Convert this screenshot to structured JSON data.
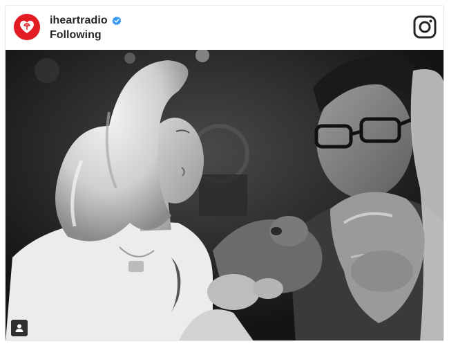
{
  "post": {
    "account": {
      "username": "iheartradio",
      "verified": true,
      "follow_status": "Following",
      "avatar_icon": "iheartradio-logo-icon",
      "brand_color": "#e31b23",
      "verified_color": "#3897f0"
    },
    "header_icon": "instagram-icon",
    "photo": {
      "style": "black-and-white",
      "tag_icon": "user-tag-icon"
    }
  }
}
